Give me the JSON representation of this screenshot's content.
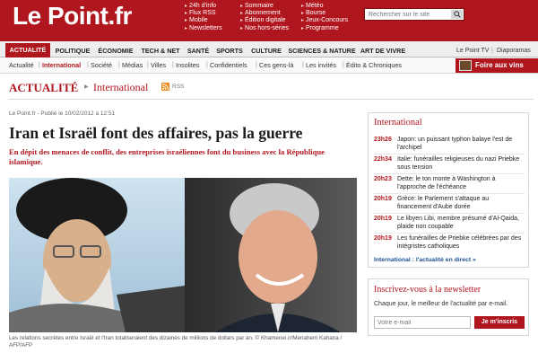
{
  "header": {
    "logo": "Le Point.fr",
    "col1": [
      "24h d'info",
      "Flux RSS",
      "Mobile",
      "Newsletters"
    ],
    "col2": [
      "Sommaire",
      "Abonnement",
      "Édition digitale",
      "Nos hors-séries"
    ],
    "col3": [
      "Météo",
      "Bourse",
      "Jeux-Concours",
      "Programme"
    ],
    "search_placeholder": "Rechercher sur le site"
  },
  "nav": {
    "tabs": [
      "ACTUALITÉ",
      "POLITIQUE",
      "ÉCONOMIE",
      "TECH & NET",
      "SANTÉ",
      "SPORTS",
      "CULTURE",
      "SCIENCES & NATURE",
      "ART DE VIVRE"
    ],
    "right": [
      "Le Point TV",
      "Diaporamas"
    ]
  },
  "subnav": {
    "items": [
      "Actualité",
      "International",
      "Société",
      "Médias",
      "Villes",
      "Insolites",
      "Confidentiels",
      "Ces gens-là",
      "Les invités",
      "Édito & Chroniques"
    ],
    "promo": "Foire aux vins"
  },
  "section": {
    "title": "ACTUALITÉ",
    "crumb": "International",
    "rss": "RSS"
  },
  "article": {
    "meta": "Le Point.fr - Publié le 10/02/2012 à 12:51",
    "headline": "Iran et Israël font des affaires, pas la guerre",
    "lead": "En dépit des menaces de conflit, des entreprises israéliennes font du business avec la République islamique.",
    "caption": "Les relations secrètes entre Israël et l'Iran totaliseraient des dizaines de millions de dollars par an. © Khamenei.ir/Menahem Kahana / AFP/AFP"
  },
  "sidebar": {
    "international_title": "International",
    "news": [
      {
        "time": "23h26",
        "text": "Japon: un puissant typhon balaye l'est de l'archipel"
      },
      {
        "time": "22h34",
        "text": "Italie: funérailles religieuses du nazi Priebke sous tension"
      },
      {
        "time": "20h23",
        "text": "Dette: le ton monte à Washington à l'approche de l'échéance"
      },
      {
        "time": "20h19",
        "text": "Grèce: le Parlement s'attaque au financement d'Aube dorée"
      },
      {
        "time": "20h19",
        "text": "Le libyen Libi, membre présumé d'Al-Qaida, plaide non coupable"
      },
      {
        "time": "20h19",
        "text": "Les funérailles de Priebke célébrées par des intégristes catholiques"
      }
    ],
    "direct_link": "International : l'actualité en direct »",
    "newsletter_title": "Inscrivez-vous à la newsletter",
    "newsletter_text": "Chaque jour, le meilleur de l'actualité par e-mail.",
    "email_placeholder": "Votre e-mail",
    "subscribe_label": "Je m'inscris"
  },
  "colors": {
    "brand": "#b0161e",
    "link": "#1d4f91"
  }
}
